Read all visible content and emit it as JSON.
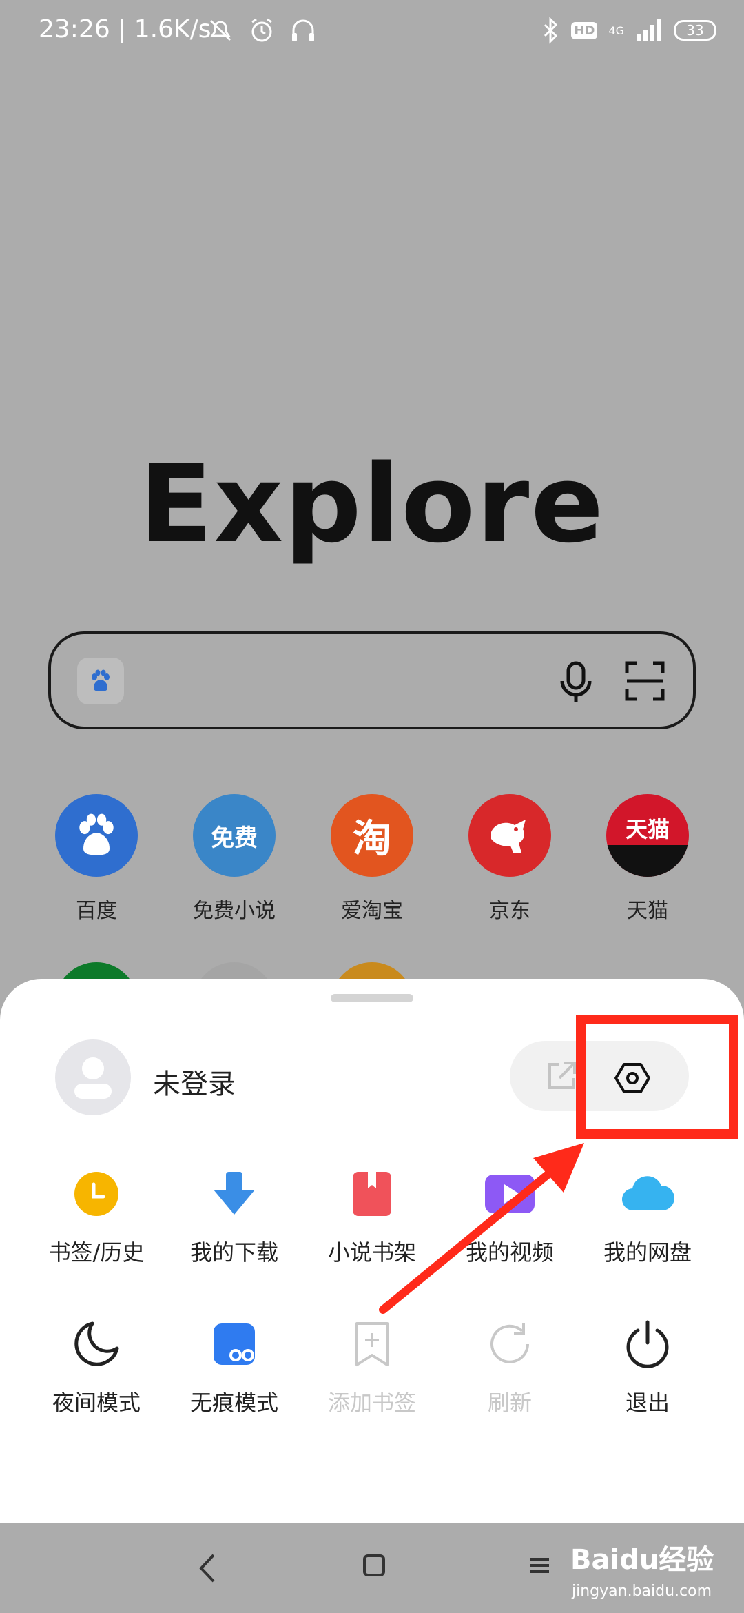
{
  "status_bar": {
    "time": "23:26 | 1.6K/s",
    "hd_badge": "HD",
    "network": "4G",
    "battery": "33",
    "icons": [
      "mute-icon",
      "alarm-icon",
      "headset-icon",
      "bluetooth-icon",
      "signal-icon"
    ]
  },
  "logo": {
    "text": "Explore"
  },
  "search": {
    "icons": [
      "paw-icon",
      "mic-icon",
      "scan-icon"
    ]
  },
  "shortcuts": [
    {
      "label": "百度",
      "glyph": "",
      "color": "#2f6ecf",
      "icon": "paw-icon"
    },
    {
      "label": "免费小说",
      "glyph": "免费",
      "color": "#3a86c8",
      "icon": "book-icon"
    },
    {
      "label": "爱淘宝",
      "glyph": "淘",
      "color": "#e2551f",
      "icon": "taobao-icon"
    },
    {
      "label": "京东",
      "glyph": "",
      "color": "#d8282a",
      "icon": "jd-dog-icon"
    },
    {
      "label": "天猫",
      "glyph": "天猫",
      "color": "#d2162a",
      "icon": "tmall-icon"
    }
  ],
  "row2_colors": [
    "#0d7a2a",
    "#a5a5a5",
    "#c98a1d"
  ],
  "sheet": {
    "user_name": "未登录",
    "menu_row1": [
      {
        "label": "书签/历史",
        "icon": "bookmark-history-icon",
        "color": "#f7b500"
      },
      {
        "label": "我的下载",
        "icon": "download-icon",
        "color": "#3a8ee6"
      },
      {
        "label": "小说书架",
        "icon": "novel-shelf-icon",
        "color": "#f0525a"
      },
      {
        "label": "我的视频",
        "icon": "video-icon",
        "color": "#8d59f5"
      },
      {
        "label": "我的网盘",
        "icon": "cloud-disk-icon",
        "color": "#36b3f0"
      }
    ],
    "menu_row2": [
      {
        "label": "夜间模式",
        "icon": "moon-icon"
      },
      {
        "label": "无痕模式",
        "icon": "incognito-icon"
      },
      {
        "label": "添加书签",
        "icon": "add-bookmark-icon"
      },
      {
        "label": "刷新",
        "icon": "refresh-icon"
      },
      {
        "label": "退出",
        "icon": "power-icon"
      }
    ]
  },
  "annotation": {
    "color": "#ff2a1a",
    "target": "settings-button"
  },
  "nav": {
    "icons": [
      "back-icon",
      "home-icon",
      "menu-icon"
    ],
    "watermark": "Baidu经验",
    "watermark_sub": "jingyan.baidu.com"
  }
}
